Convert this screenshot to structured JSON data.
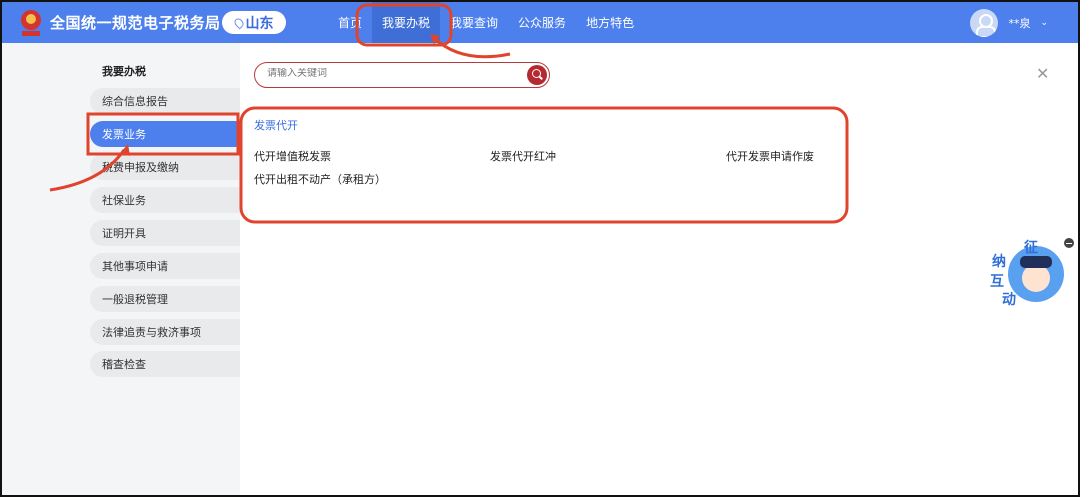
{
  "header": {
    "site_title": "全国统一规范电子税务局",
    "region": "山东",
    "nav": [
      "首页",
      "我要办税",
      "我要查询",
      "公众服务",
      "地方特色"
    ],
    "user_name": "**泉"
  },
  "sidebar": {
    "title": "我要办税",
    "items": [
      "综合信息报告",
      "发票业务",
      "税费申报及缴纳",
      "社保业务",
      "证明开具",
      "其他事项申请",
      "一般退税管理",
      "法律追责与救济事项",
      "稽查检查"
    ],
    "active": "发票业务"
  },
  "search": {
    "placeholder": "请输入关键词"
  },
  "content": {
    "category": "发票代开",
    "services": [
      "代开增值税发票",
      "发票代开红冲",
      "代开发票申请作废",
      "代开出租不动产（承租方）"
    ]
  },
  "mascot": {
    "text": "征纳互动"
  },
  "colors": {
    "header": "#4d80ec",
    "accent": "#3a6de0",
    "annotation": "#e0442c"
  }
}
